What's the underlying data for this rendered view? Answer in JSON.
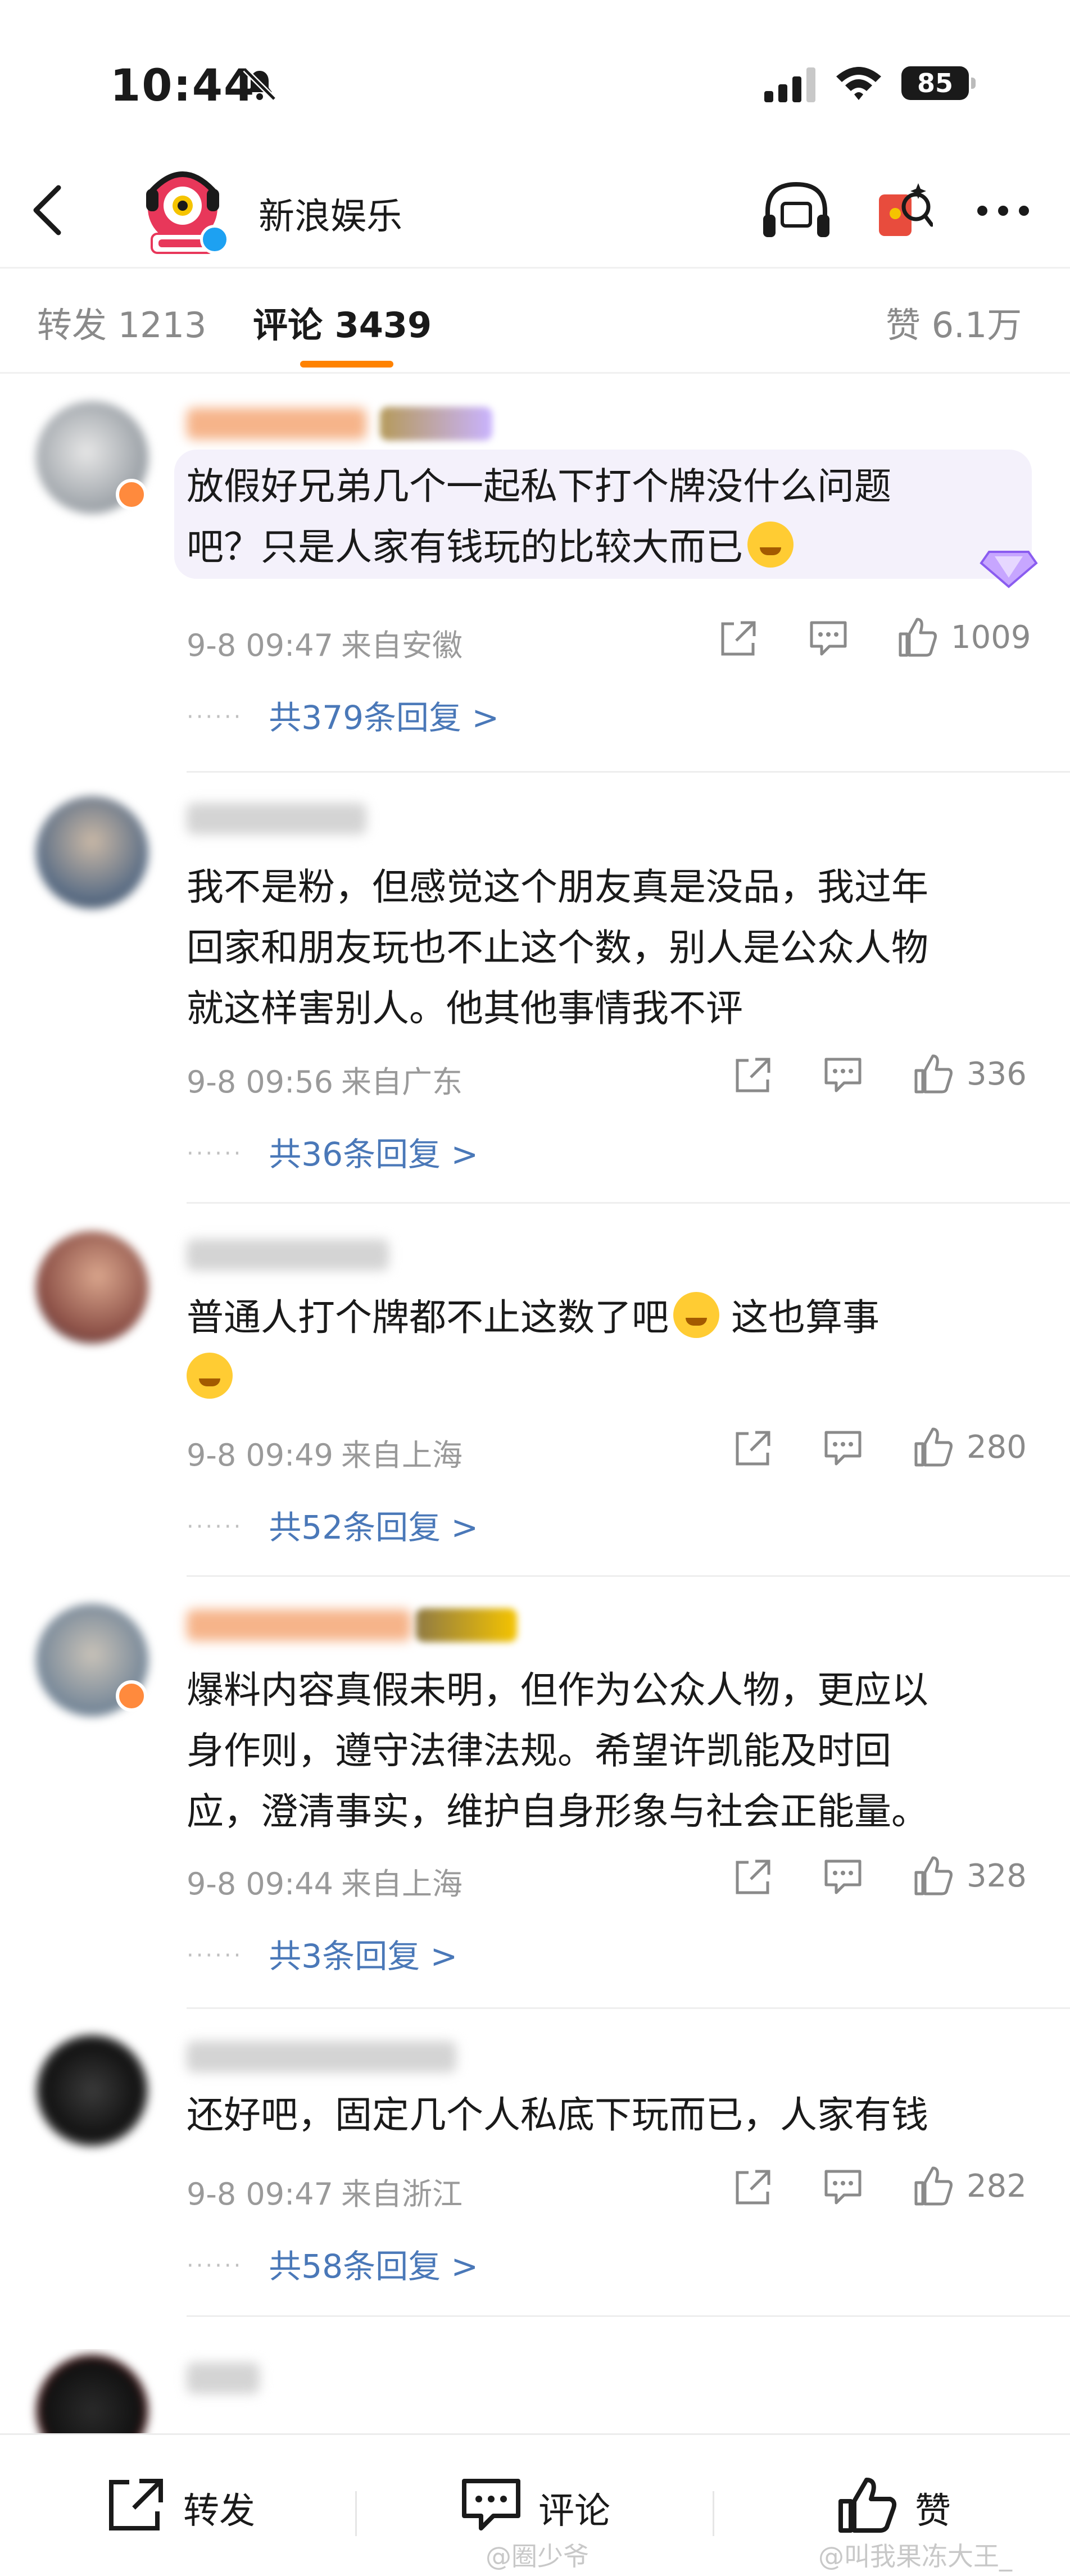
{
  "status_bar": {
    "time": "10:44",
    "battery": "85"
  },
  "header": {
    "back_icon": "chevron-left-icon",
    "channel_name": "新浪娱乐",
    "icons": [
      "listen-icon",
      "red-packet-icon",
      "more-icon"
    ]
  },
  "tabs": {
    "repost": "转发 1213",
    "comment": "评论 3439",
    "like": "赞 6.1万",
    "active": "comment",
    "accent_color": "#ff8200"
  },
  "comments": [
    {
      "text_line1": "放假好兄弟几个一起私下打个牌没什么问题",
      "text_line2": "吧？只是人家有钱玩的比较大而已",
      "date": "9-8 09:47",
      "location": "来自安徽",
      "likes": "1009",
      "replies": "共379条回复 >"
    },
    {
      "text_line1": "我不是粉，但感觉这个朋友真是没品，我过年",
      "text_line2": "回家和朋友玩也不止这个数，别人是公众人物",
      "text_line3": "就这样害别人。他其他事情我不评",
      "date": "9-8 09:56",
      "location": "来自广东",
      "likes": "336",
      "replies": "共36条回复 >"
    },
    {
      "text_line1": "普通人打个牌都不止这数了吧",
      "text_line1b": "这也算事",
      "date": "9-8 09:49",
      "location": "来自上海",
      "likes": "280",
      "replies": "共52条回复 >"
    },
    {
      "text_line1": "爆料内容真假未明，但作为公众人物，更应以",
      "text_line2": "身作则，遵守法律法规。希望许凯能及时回",
      "text_line3": "应，澄清事实，维护自身形象与社会正能量。",
      "date": "9-8 09:44",
      "location": "来自上海",
      "likes": "328",
      "replies": "共3条回复 >"
    },
    {
      "text_line1": "还好吧，固定几个人私底下玩而已，人家有钱",
      "date": "9-8 09:47",
      "location": "来自浙江",
      "likes": "282",
      "replies": "共58条回复 >"
    }
  ],
  "bottom_bar": {
    "repost_label": "转发",
    "comment_label": "评论",
    "like_label": "赞"
  },
  "watermark": {
    "left": "@圈少爷",
    "right": "@叫我果冻大王_"
  },
  "reply_color": "#4a78b8"
}
